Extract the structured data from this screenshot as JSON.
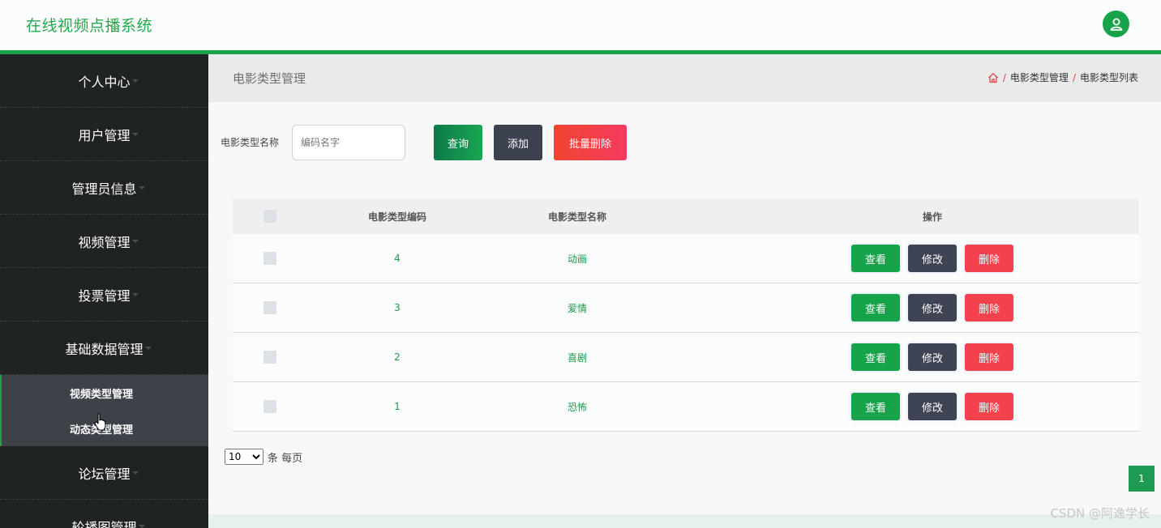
{
  "app": {
    "title": "在线视频点播系统"
  },
  "colors": {
    "primary": "#17a34a",
    "sidebar_bg": "#1f2321",
    "danger": "#f4414e",
    "dark_button": "#3c4150"
  },
  "sidebar": {
    "items": [
      {
        "label": "个人中心"
      },
      {
        "label": "用户管理"
      },
      {
        "label": "管理员信息"
      },
      {
        "label": "视频管理"
      },
      {
        "label": "投票管理"
      },
      {
        "label": "基础数据管理"
      }
    ],
    "submenu": [
      {
        "label": "视频类型管理"
      },
      {
        "label": "动态类型管理"
      }
    ],
    "after_items": [
      {
        "label": "论坛管理"
      },
      {
        "label": "轮播图管理"
      }
    ]
  },
  "page": {
    "title": "电影类型管理",
    "breadcrumb": [
      "电影类型管理",
      "电影类型列表"
    ],
    "breadcrumb_sep": "/"
  },
  "search": {
    "label": "电影类型名称",
    "placeholder": "编码名字",
    "query_label": "查询",
    "add_label": "添加",
    "batch_delete_label": "批量删除"
  },
  "table": {
    "headers": {
      "code": "电影类型编码",
      "name": "电影类型名称",
      "ops": "操作"
    },
    "rows": [
      {
        "code": "4",
        "name": "动画"
      },
      {
        "code": "3",
        "name": "爱情"
      },
      {
        "code": "2",
        "name": "喜剧"
      },
      {
        "code": "1",
        "name": "恐怖"
      }
    ],
    "actions": {
      "view": "查看",
      "edit": "修改",
      "delete": "删除"
    }
  },
  "pagination": {
    "page_size": "10",
    "per_page_text": "条 每页",
    "current_page": "1"
  },
  "watermark": "CSDN @阿逸学长"
}
